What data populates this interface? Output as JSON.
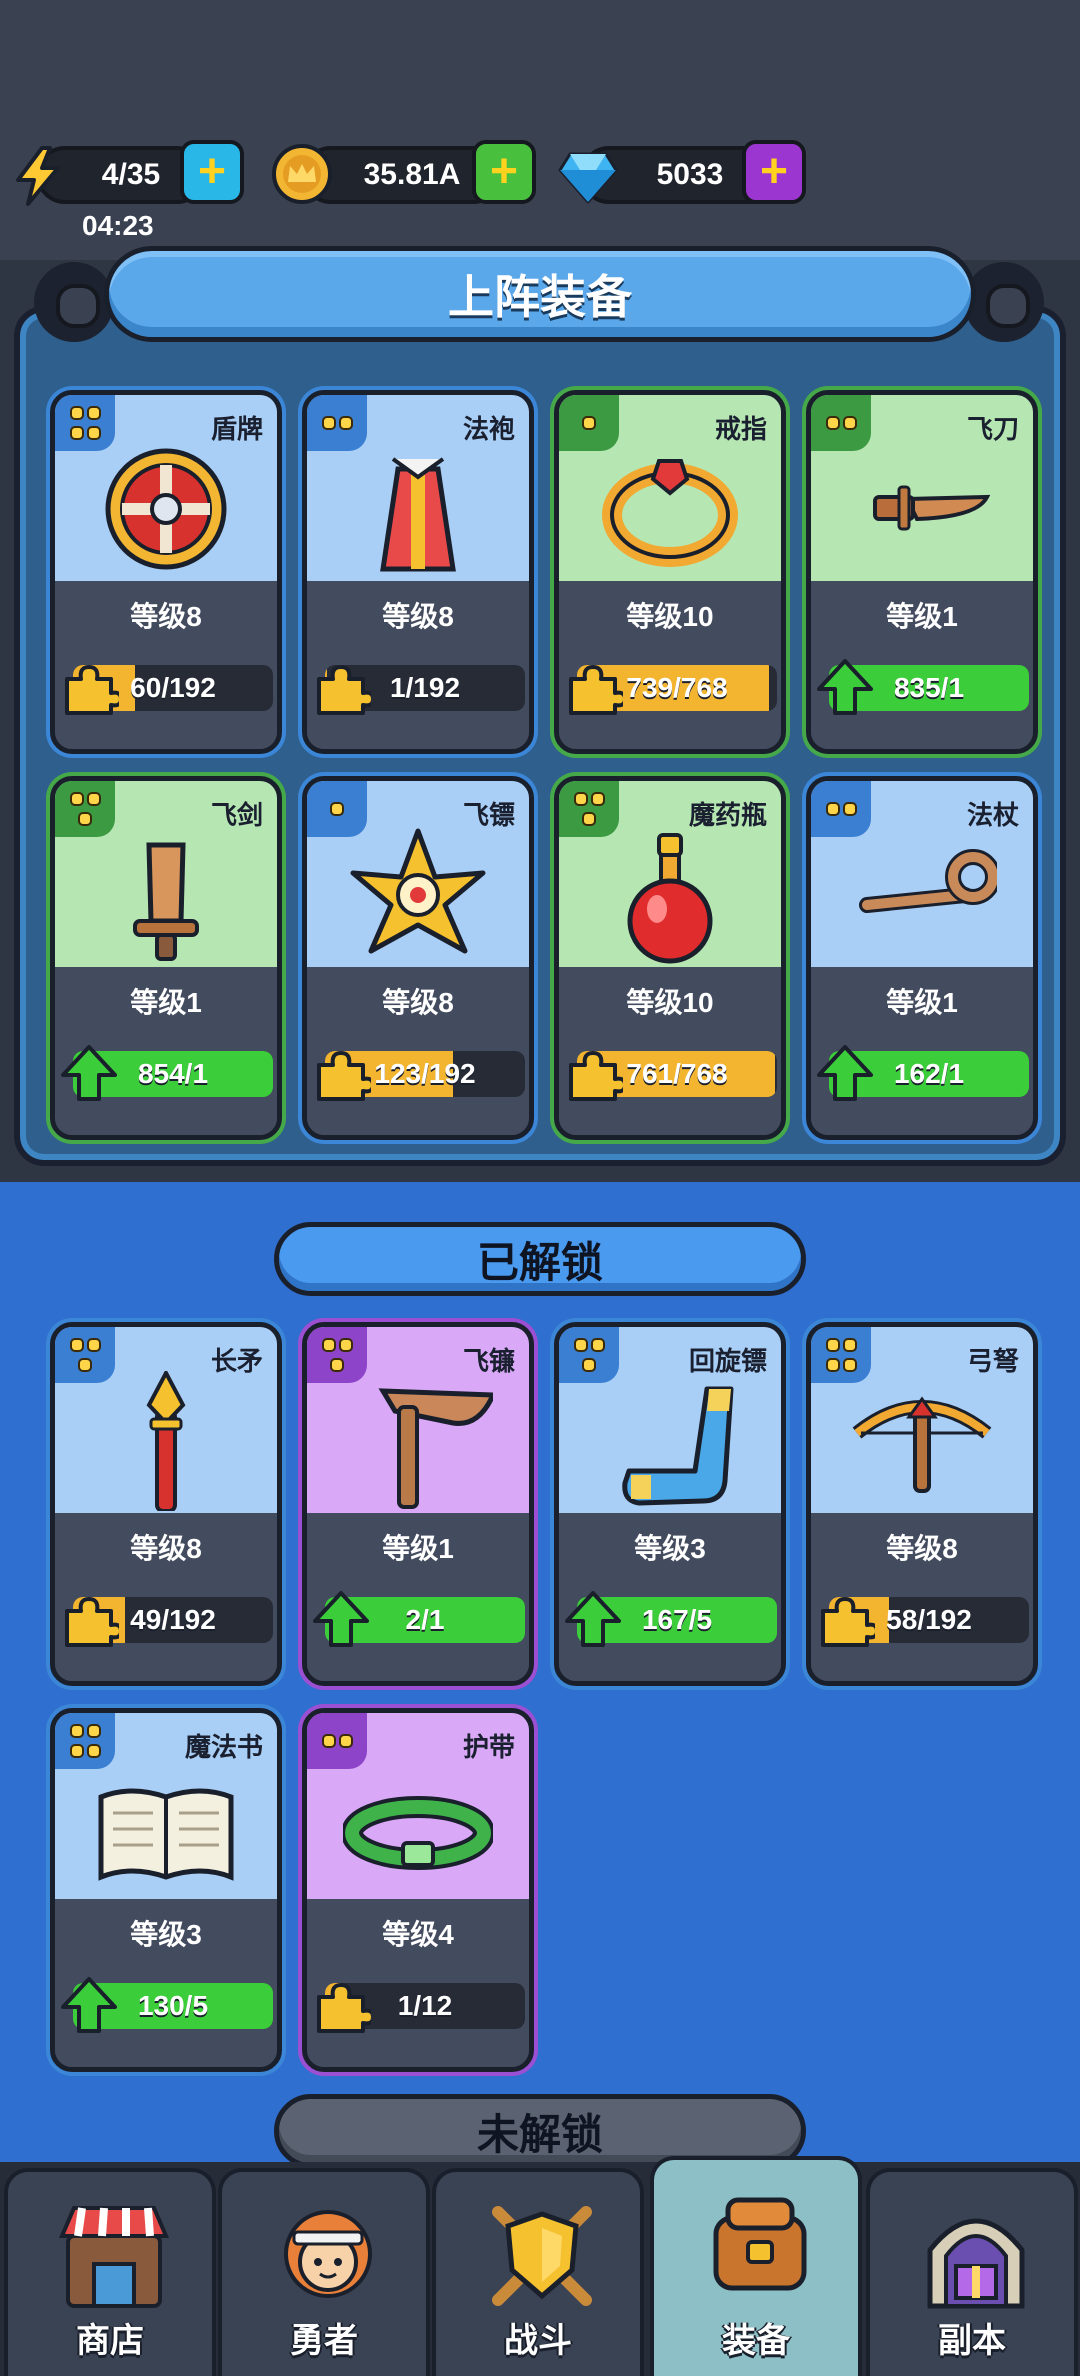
{
  "resources": {
    "energy": "4/35",
    "energy_timer": "04:23",
    "gold": "35.81A",
    "gems": "5033"
  },
  "sections": {
    "equipped_title": "上阵装备",
    "unlocked_title": "已解锁",
    "locked_title": "未解锁"
  },
  "equipped": [
    {
      "name": "盾牌",
      "level": "等级8",
      "progress": "60/192",
      "fill": 0.31,
      "rarity": "blue",
      "lead": "puzzle"
    },
    {
      "name": "法袍",
      "level": "等级8",
      "progress": "1/192",
      "fill": 0.01,
      "rarity": "blue",
      "lead": "puzzle"
    },
    {
      "name": "戒指",
      "level": "等级10",
      "progress": "739/768",
      "fill": 0.96,
      "rarity": "green",
      "lead": "puzzle"
    },
    {
      "name": "飞刀",
      "level": "等级1",
      "progress": "835/1",
      "fill": 1,
      "rarity": "green",
      "lead": "arrow"
    },
    {
      "name": "飞剑",
      "level": "等级1",
      "progress": "854/1",
      "fill": 1,
      "rarity": "green",
      "lead": "arrow"
    },
    {
      "name": "飞镖",
      "level": "等级8",
      "progress": "123/192",
      "fill": 0.64,
      "rarity": "blue",
      "lead": "puzzle"
    },
    {
      "name": "魔药瓶",
      "level": "等级10",
      "progress": "761/768",
      "fill": 0.99,
      "rarity": "green",
      "lead": "puzzle"
    },
    {
      "name": "法杖",
      "level": "等级1",
      "progress": "162/1",
      "fill": 1,
      "rarity": "blue",
      "lead": "arrow"
    }
  ],
  "unlocked": [
    {
      "name": "长矛",
      "level": "等级8",
      "progress": "49/192",
      "fill": 0.26,
      "rarity": "blue",
      "lead": "puzzle"
    },
    {
      "name": "飞镰",
      "level": "等级1",
      "progress": "2/1",
      "fill": 1,
      "rarity": "purple",
      "lead": "arrow"
    },
    {
      "name": "回旋镖",
      "level": "等级3",
      "progress": "167/5",
      "fill": 1,
      "rarity": "blue",
      "lead": "arrow"
    },
    {
      "name": "弓弩",
      "level": "等级8",
      "progress": "58/192",
      "fill": 0.3,
      "rarity": "blue",
      "lead": "puzzle"
    },
    {
      "name": "魔法书",
      "level": "等级3",
      "progress": "130/5",
      "fill": 1,
      "rarity": "blue",
      "lead": "arrow"
    },
    {
      "name": "护带",
      "level": "等级4",
      "progress": "1/12",
      "fill": 0.08,
      "rarity": "purple",
      "lead": "puzzle"
    }
  ],
  "nav": {
    "tabs": [
      {
        "label": "商店",
        "icon": "shop-icon"
      },
      {
        "label": "勇者",
        "icon": "hero-icon"
      },
      {
        "label": "战斗",
        "icon": "battle-icon"
      },
      {
        "label": "装备",
        "icon": "equipment-icon",
        "active": true
      },
      {
        "label": "副本",
        "icon": "dungeon-icon"
      }
    ]
  },
  "colors": {
    "blue_rarity": "#a9cff6",
    "green_rarity": "#b6e6b2",
    "purple_rarity": "#d9a8f6",
    "progress_gold": "#f3b530",
    "progress_green": "#3ccd3a"
  }
}
